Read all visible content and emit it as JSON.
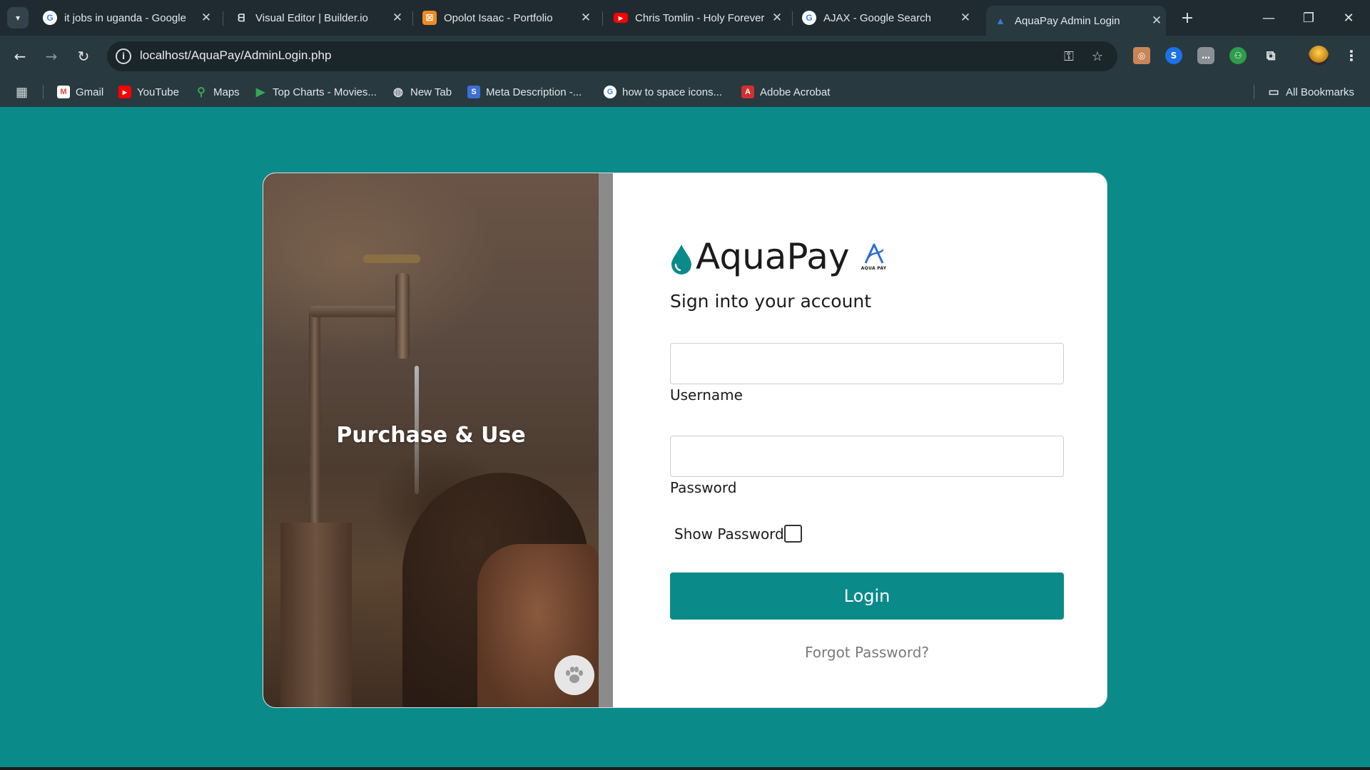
{
  "browser": {
    "tabs": [
      {
        "title": "it jobs in uganda - Google",
        "icon": "google-icon"
      },
      {
        "title": "Visual Editor | Builder.io",
        "icon": "builder-icon"
      },
      {
        "title": "Opolot Isaac - Portfolio",
        "icon": "portfolio-icon"
      },
      {
        "title": "Chris Tomlin - Holy Forever",
        "icon": "youtube-icon"
      },
      {
        "title": "AJAX - Google Search",
        "icon": "google-icon"
      },
      {
        "title": "AquaPay Admin Login",
        "icon": "aquapay-icon",
        "active": true
      }
    ],
    "url": "localhost/AquaPay/AdminLogin.php",
    "bookmarks": [
      {
        "label": "Gmail",
        "icon": "gmail-icon"
      },
      {
        "label": "YouTube",
        "icon": "youtube-icon"
      },
      {
        "label": "Maps",
        "icon": "maps-icon"
      },
      {
        "label": "Top Charts - Movies...",
        "icon": "play-icon"
      },
      {
        "label": "New Tab",
        "icon": "globe-icon"
      },
      {
        "label": "Meta Description -...",
        "icon": "s-icon"
      },
      {
        "label": "how to space icons...",
        "icon": "google-icon"
      },
      {
        "label": "Adobe Acrobat",
        "icon": "acrobat-icon"
      }
    ],
    "all_bookmarks_label": "All Bookmarks"
  },
  "hero": {
    "title": "Purchase & Use"
  },
  "brand": {
    "name": "AquaPay",
    "mark_text": "AQUA PAY",
    "accent_color": "#0b8a8a"
  },
  "form": {
    "subtitle": "Sign into your account",
    "username_label": "Username",
    "username_value": "",
    "password_label": "Password",
    "password_value": "",
    "show_password_label": "Show Password",
    "show_password_checked": false,
    "login_label": "Login",
    "forgot_label": "Forgot Password?"
  }
}
